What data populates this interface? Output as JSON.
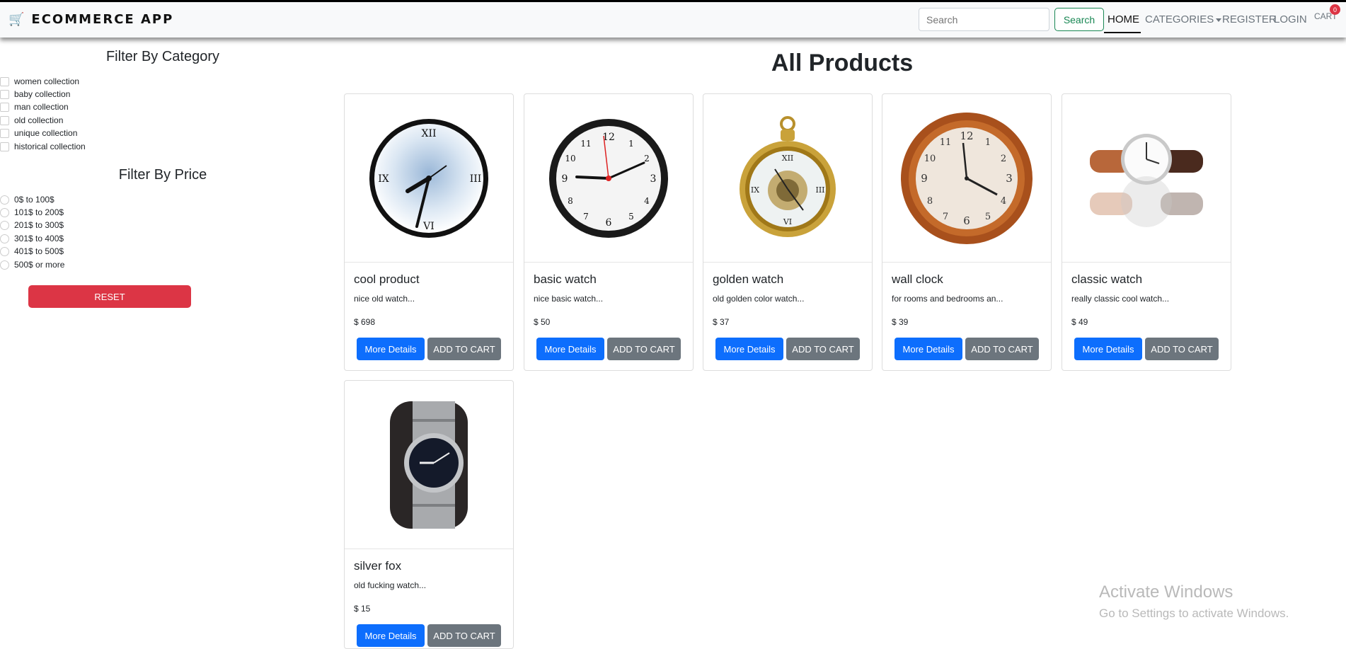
{
  "navbar": {
    "brand": "ECOMMERCE APP",
    "search_placeholder": "Search",
    "search_button": "Search",
    "links": {
      "home": "HOME",
      "categories": "CATEGORIES",
      "register": "REGISTER",
      "login": "LOGIN",
      "cart": "CART"
    },
    "cart_count": "0"
  },
  "sidebar": {
    "category_title": "Filter By Category",
    "categories": [
      "women collection",
      "baby collection",
      "man collection",
      "old collection",
      "unique collection",
      "historical collection"
    ],
    "price_title": "Filter By Price",
    "prices": [
      "0$ to 100$",
      "101$ to 200$",
      "201$ to 300$",
      "301$ to 400$",
      "401$ to 500$",
      "500$ or more"
    ],
    "reset": "RESET"
  },
  "main": {
    "title": "All Products",
    "more_details": "More Details",
    "add_to_cart": "ADD TO CART",
    "products": [
      {
        "name": "cool product",
        "desc": "nice old watch...",
        "price": "$ 698"
      },
      {
        "name": "basic watch",
        "desc": "nice basic watch...",
        "price": "$ 50"
      },
      {
        "name": "golden watch",
        "desc": "old golden color watch...",
        "price": "$ 37"
      },
      {
        "name": "wall clock",
        "desc": "for rooms and bedrooms an...",
        "price": "$ 39"
      },
      {
        "name": "classic watch",
        "desc": "really classic cool watch...",
        "price": "$ 49"
      },
      {
        "name": "silver fox",
        "desc": "old fucking watch...",
        "price": "$ 15"
      }
    ]
  },
  "watermark": {
    "line1": "Activate Windows",
    "line2": "Go to Settings to activate Windows."
  },
  "colors": {
    "primary": "#0d6efd",
    "secondary": "#6c757d",
    "danger": "#dc3545",
    "success": "#198754"
  }
}
